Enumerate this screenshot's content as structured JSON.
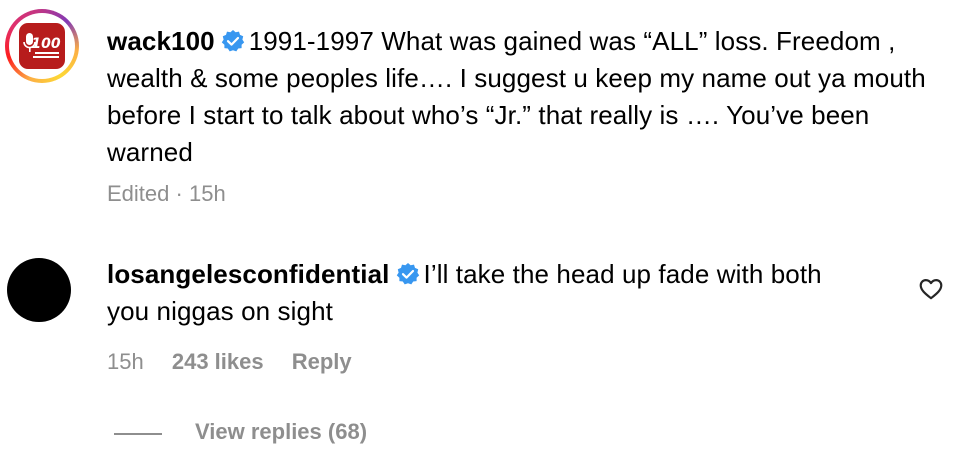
{
  "comments": [
    {
      "username": "wack100",
      "verified": true,
      "text": "1991-1997 What was gained was “ALL” loss. Freedom , wealth & some peoples life…. I suggest u keep my name out ya mouth before I start to talk about who’s “Jr.” that really is …. You’ve been warned",
      "edited": "Edited",
      "separator": "·",
      "time": "15h",
      "avatar_text": "100",
      "avatar_color": "#b71c1c"
    },
    {
      "username": "losangelesconfidential",
      "verified": true,
      "text": "I’ll take the head up fade with both you niggas on sight",
      "time": "15h",
      "likes": "243 likes",
      "reply": "Reply",
      "avatar_color": "#000000"
    }
  ],
  "view_replies": "View replies (68)",
  "icons": {
    "verified": "verified-badge-icon",
    "heart": "heart-icon"
  },
  "colors": {
    "verified_blue": "#3897f0",
    "muted_text": "#8e8e8e"
  }
}
